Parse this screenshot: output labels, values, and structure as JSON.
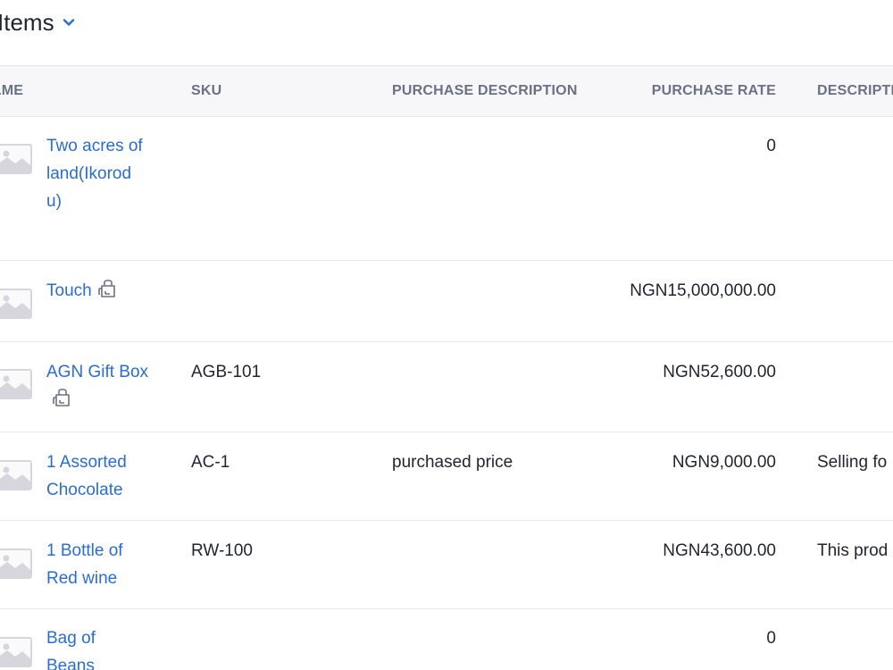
{
  "header": {
    "title": "Items"
  },
  "table": {
    "columns": {
      "name": "AME",
      "sku": "SKU",
      "purchase_description": "PURCHASE DESCRIPTION",
      "purchase_rate": "PURCHASE RATE",
      "description": "DESCRIPTI"
    },
    "rows": [
      {
        "name": "Two acres of land(Ikorodu)",
        "sku": "",
        "purchase_description": "",
        "purchase_rate": "0",
        "description": ""
      },
      {
        "name": "Touch",
        "sku": "",
        "purchase_description": "",
        "purchase_rate": "NGN15,000,000.00",
        "description": ""
      },
      {
        "name": "AGN Gift Box",
        "sku": "AGB-101",
        "purchase_description": "",
        "purchase_rate": "NGN52,600.00",
        "description": ""
      },
      {
        "name": "1 Assorted Chocolate",
        "sku": "AC-1",
        "purchase_description": "purchased price",
        "purchase_rate": "NGN9,000.00",
        "description": "Selling fo"
      },
      {
        "name": "1 Bottle of Red wine",
        "sku": "RW-100",
        "purchase_description": "",
        "purchase_rate": "NGN43,600.00",
        "description": "This prod"
      },
      {
        "name": "Bag of Beans",
        "sku": "",
        "purchase_description": "",
        "purchase_rate": "0",
        "description": ""
      }
    ]
  },
  "colors": {
    "link": "#2a6dd1",
    "header_bg": "#f7f7fa",
    "header_text": "#6b7185",
    "text": "#1f2430"
  }
}
